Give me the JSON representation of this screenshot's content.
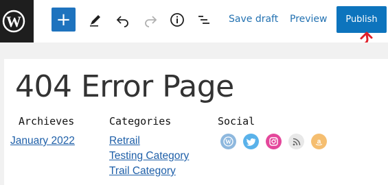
{
  "toolbar": {
    "save_draft_label": "Save draft",
    "preview_label": "Preview",
    "publish_label": "Publish",
    "add_block_symbol": "+"
  },
  "page": {
    "title": "404 Error Page"
  },
  "columns": {
    "archives": {
      "heading": "Archieves",
      "links": [
        "January 2022"
      ]
    },
    "categories": {
      "heading": "Categories",
      "links": [
        "Retrail",
        "Testing Category",
        "Trail Category"
      ]
    },
    "social": {
      "heading": "Social",
      "icons": [
        "wordpress-icon",
        "twitter-icon",
        "instagram-icon",
        "rss-icon",
        "amazon-icon"
      ]
    }
  },
  "colors": {
    "accent": "#1e73be",
    "publish": "#0d74bd",
    "link": "#1e5fa8",
    "annotation_arrow": "#e0202a"
  }
}
